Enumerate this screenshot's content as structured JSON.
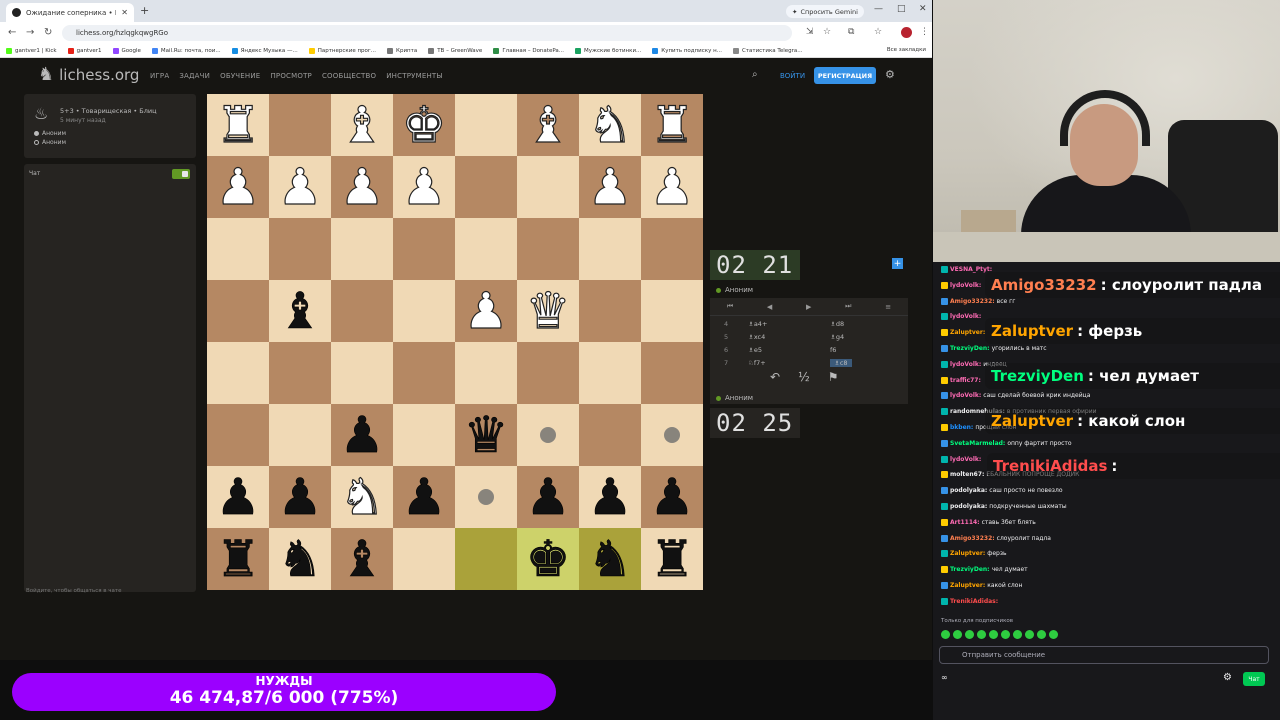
{
  "browser": {
    "tab_title": "Ожидание соперника • Игра в",
    "url": "lichess.org/hzlqgkqwgRGo",
    "gemini_label": "Спросить Gemini",
    "bookmarks": [
      "gantver1 | Kick",
      "gantver1",
      "Google",
      "Mail.Ru: почта, пои...",
      "Яндекс Музыка —...",
      "Партнерские прог...",
      "Крипта",
      "TB – GreenWave",
      "Главная – DonatePa...",
      "Мужские ботинки...",
      "Купить подписку н...",
      "Статистика Telegra..."
    ],
    "bookmarks_all": "Все закладки"
  },
  "lichess": {
    "logo": "lichess.org",
    "nav": [
      "ИГРА",
      "ЗАДАЧИ",
      "ОБУЧЕНИЕ",
      "ПРОСМОТР",
      "СООБЩЕСТВО",
      "ИНСТРУМЕНТЫ"
    ],
    "login": "ВОЙТИ",
    "signup": "РЕГИСТРАЦИЯ",
    "game_title": "5+3 • Товарищеская • Блиц",
    "game_time": "5 минут назад",
    "player1": "Аноним",
    "player2": "Аноним",
    "chat_label": "Чат",
    "chat_hint": "Войдите, чтобы общаться в чате",
    "clock_top": "02 21",
    "clock_bottom": "02 25",
    "opponent": "Аноним",
    "me": "Аноним",
    "moves": [
      {
        "n": "4",
        "w": "♗a4+",
        "b": "♗d8"
      },
      {
        "n": "5",
        "w": "♗xc4",
        "b": "♗g4"
      },
      {
        "n": "6",
        "w": "♗e5",
        "b": "f6"
      },
      {
        "n": "7",
        "w": "♘f7+",
        "b": "♗c8"
      }
    ],
    "draw_label": "½"
  },
  "board": [
    [
      "wR",
      "",
      "wB",
      "wK",
      "",
      "wB",
      "wN",
      "wR"
    ],
    [
      "wP",
      "wP",
      "wP",
      "wP",
      "",
      "",
      "wP",
      "wP"
    ],
    [
      "",
      "",
      "",
      "",
      "",
      "",
      "",
      ""
    ],
    [
      "",
      "bB",
      "",
      "",
      "wP",
      "wQ",
      "",
      ""
    ],
    [
      "",
      "",
      "",
      "",
      "",
      "",
      "",
      ""
    ],
    [
      "",
      "",
      "bP",
      "",
      "bQ",
      "",
      "",
      ""
    ],
    [
      "bP",
      "bP",
      "wN",
      "bP",
      "",
      "bP",
      "bP",
      "bP"
    ],
    [
      "bR",
      "bN",
      "bB",
      "",
      "",
      "bK",
      "bN",
      "bR"
    ]
  ],
  "pieces": {
    "K": "♚",
    "Q": "♛",
    "R": "♜",
    "B": "♝",
    "N": "♞",
    "P": "♟"
  },
  "chat": {
    "lines": [
      {
        "user": "VESNA_Ptyt:",
        "text": "",
        "color": "#ff6bb5"
      },
      {
        "user": "lydoVolk:",
        "text": "",
        "color": "#ff6bb5"
      },
      {
        "user": "Amigo33232:",
        "text": "все гг",
        "color": "#ff7f50"
      },
      {
        "user": "lydoVolk:",
        "text": "",
        "color": "#ff6bb5"
      },
      {
        "user": "Zaluptver:",
        "text": "",
        "color": "#ffa500"
      },
      {
        "user": "TrezviyDen:",
        "text": "угорились в матс",
        "color": "#00ff7f"
      },
      {
        "user": "lydoVolk:",
        "text": "индеец",
        "color": "#ff6bb5"
      },
      {
        "user": "traffic77:",
        "text": "",
        "color": "#ff6bb5"
      },
      {
        "user": "lydoVolk:",
        "text": "саш сделай боевой крик индейца",
        "color": "#ff6bb5"
      },
      {
        "user": "randomnehulas:",
        "text": "в противник первая офирии",
        "color": "#efeff1"
      },
      {
        "user": "bkben:",
        "text": "прощай слон",
        "color": "#1e90ff"
      },
      {
        "user": "SvetaMarmelad:",
        "text": "оппу фартит просто",
        "color": "#00ff7f"
      },
      {
        "user": "lydoVolk:",
        "text": "",
        "color": "#ff6bb5"
      },
      {
        "user": "molten67:",
        "text": "ЕБАЛЬНИК ПОПРОЩЕ ДОДИК",
        "color": "#efeff1"
      },
      {
        "user": "podolyaka:",
        "text": "саш просто не повезло",
        "color": "#efeff1"
      },
      {
        "user": "podolyaka:",
        "text": "подкрученные шахматы",
        "color": "#efeff1"
      },
      {
        "user": "Art1114:",
        "text": "ставь 3бет блять",
        "color": "#ff6bb5"
      },
      {
        "user": "Amigo33232:",
        "text": "слоуролит падла",
        "color": "#ff7f50"
      },
      {
        "user": "Zaluptver:",
        "text": "ферзь",
        "color": "#ffa500"
      },
      {
        "user": "TrezviyDen:",
        "text": "чел думает",
        "color": "#00ff7f"
      },
      {
        "user": "Zaluptver:",
        "text": "какой слон",
        "color": "#ffa500"
      },
      {
        "user": "TrenikiAdidas:",
        "text": "",
        "color": "#ff4d4d"
      }
    ],
    "highlights": [
      {
        "user": "Amigo33232",
        "text": ": слоуролит падла",
        "color": "#ff7f50"
      },
      {
        "user": "Zaluptver",
        "text": ": ферзь",
        "color": "#ffa500"
      },
      {
        "user": "TrezviyDen",
        "text": ": чел думает",
        "color": "#00ff7f"
      },
      {
        "user": "Zaluptver",
        "text": ": какой слон",
        "color": "#ffa500"
      },
      {
        "user": "TrenikiAdidas",
        "text": ":",
        "color": "#ff4d4d"
      }
    ],
    "subonly": "Только для подписчиков",
    "placeholder": "Отправить сообщение",
    "chat_button": "Чат",
    "infinity": "∞"
  },
  "donation": {
    "title": "НУЖДЫ",
    "amount": "46 474,87/6 000 (775%)"
  }
}
